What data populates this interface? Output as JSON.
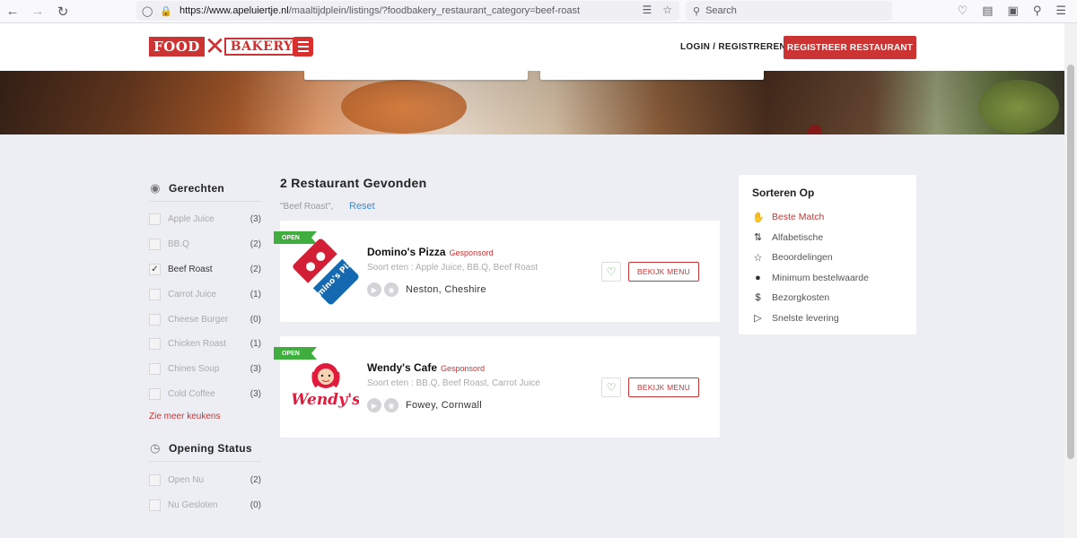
{
  "browser": {
    "url_host": "https://www.apeluiertje.nl",
    "url_path": "/maaltijdplein/listings/?foodbakery_restaurant_category=beef-roast",
    "search_placeholder": "Search"
  },
  "header": {
    "logo_food": "FOOD",
    "logo_bakery": "BAKERY",
    "login_label": "LOGIN / REGISTREREN",
    "register_label": "REGISTREER RESTAURANT"
  },
  "filters": {
    "heading": "Gerechten",
    "items": [
      {
        "name": "Apple Juice",
        "count": "(3)",
        "checked": false
      },
      {
        "name": "BB.Q",
        "count": "(2)",
        "checked": false
      },
      {
        "name": "Beef Roast",
        "count": "(2)",
        "checked": true
      },
      {
        "name": "Carrot Juice",
        "count": "(1)",
        "checked": false
      },
      {
        "name": "Cheese Burger",
        "count": "(0)",
        "checked": false
      },
      {
        "name": "Chicken Roast",
        "count": "(1)",
        "checked": false
      },
      {
        "name": "Chines Soup",
        "count": "(3)",
        "checked": false
      },
      {
        "name": "Cold Coffee",
        "count": "(3)",
        "checked": false
      }
    ],
    "more_link": "Zie meer keukens",
    "status_heading": "Opening Status",
    "status_items": [
      {
        "name": "Open Nu",
        "count": "(2)"
      },
      {
        "name": "Nu Gesloten",
        "count": "(0)"
      }
    ]
  },
  "results": {
    "title": "2 Restaurant Gevonden",
    "active_filter": "\"Beef Roast\",",
    "reset_label": "Reset",
    "restaurants": [
      {
        "badge": "OPEN",
        "name": "Domino's Pizza",
        "sponsored": "Gesponsord",
        "categories": "Soort eten : Apple Juice, BB.Q, Beef Roast",
        "location": "Neston, Cheshire",
        "button": "BEKIJK MENU",
        "logo_text": "Domino's Pizza"
      },
      {
        "badge": "OPEN",
        "name": "Wendy's Cafe",
        "sponsored": "Gesponsord",
        "categories": "Soort eten : BB.Q, Beef Roast, Carrot Juice",
        "location": "Fowey, Cornwall",
        "button": "BEKIJK MENU",
        "logo_text": "Wendy's"
      }
    ]
  },
  "sort": {
    "title": "Sorteren Op",
    "items": [
      {
        "label": "Beste Match",
        "icon": "thumbs-up-icon",
        "active": true
      },
      {
        "label": "Alfabetische",
        "icon": "sort-alpha-icon",
        "active": false
      },
      {
        "label": "Beoordelingen",
        "icon": "star-icon",
        "active": false
      },
      {
        "label": "Minimum bestelwaarde",
        "icon": "user-icon",
        "active": false
      },
      {
        "label": "Bezorgkosten",
        "icon": "dollar-icon",
        "active": false
      },
      {
        "label": "Snelste levering",
        "icon": "fast-forward-icon",
        "active": false
      }
    ]
  },
  "colors": {
    "brand_red": "#cc3333",
    "open_green": "#3fae3f",
    "link_blue": "#3a8bd6"
  }
}
